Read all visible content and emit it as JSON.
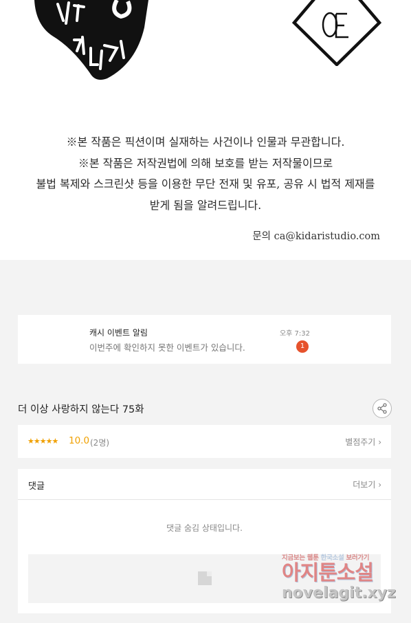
{
  "header_logos": {
    "left_logo_name": "kidari-logo",
    "right_logo_name": "oe-logo"
  },
  "notice": {
    "lines": [
      "※본 작품은 픽션이며 실재하는 사건이나 인물과 무관합니다.",
      "※본 작품은 저작권법에 의해 보호를 받는 저작물이므로",
      "불법 복제와 스크린샷 등을 이용한 무단 전재 및 유포, 공유 시 법적 제재를",
      "받게 됨을 알려드립니다."
    ],
    "contact": "문의 ca@kidaristudio.com"
  },
  "notification": {
    "title": "캐시 이벤트 알림",
    "message": "이번주에 확인하지 못한 이벤트가 있습니다.",
    "time": "오후 7:32",
    "badge_count": "1",
    "badge_color": "#e6522c"
  },
  "episode": {
    "title": "더 이상 사랑하지 않는다 75화",
    "share_icon": "share-icon"
  },
  "rating": {
    "stars": "★★★★★",
    "score": "10.0",
    "voters": "(2명)",
    "rate_button": "별점주기",
    "accent_color": "#f0a000"
  },
  "comments": {
    "title": "댓글",
    "more": "더보기",
    "hidden_message": "댓글 숨김 상태입니다."
  },
  "watermark": {
    "tagline_prefix": "지금보는 웹툰",
    "tagline_highlight": "한국소설",
    "tagline_suffix": "보러가기",
    "brand": "아지툰소설",
    "url": "novelagit.xyz"
  }
}
